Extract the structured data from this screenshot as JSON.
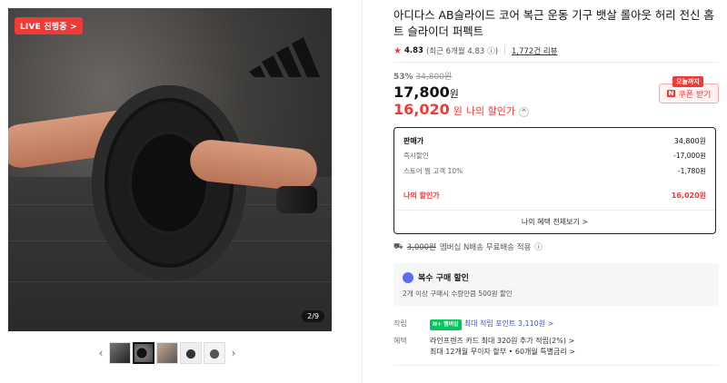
{
  "image": {
    "live_badge": "LIVE 진행중 >",
    "counter": "2/9"
  },
  "thumbs": {
    "prev": "‹",
    "next": "›"
  },
  "product": {
    "title": "아디다스 AB슬라이드 코어 복근 운동 기구 뱃살 롤아웃 허리 전신 홈트 슬라이더 퍼펙트",
    "rating": "4.83",
    "rating_sub": "(최근 6개월 4.83",
    "reviews": "1,772건 리뷰",
    "discount_pct": "53%",
    "orig_price": "34,800원",
    "price": "17,800",
    "price_unit": "원",
    "my_price": "16,020",
    "my_price_unit": "원",
    "my_price_label": "나의 할인가"
  },
  "coupon": {
    "today": "오늘까지",
    "n": "N",
    "label": "쿠폰 받기"
  },
  "breakdown": {
    "rows": [
      {
        "label": "판매가",
        "value": "34,800원"
      },
      {
        "label": "즉시할인",
        "value": "-17,000원"
      },
      {
        "label": "스토어 찜 고객 10%",
        "value": "-1,780원"
      }
    ],
    "my_label": "나의 할인가",
    "my_value": "16,020원",
    "foot": "나의 혜택 전체보기 >"
  },
  "shipping": {
    "strike": "3,000원",
    "text": "멤버십 N배송 무료배송 적용"
  },
  "multi": {
    "title": "복수 구매 할인",
    "desc": "2개 이상 구매시 수량만큼 500원 할인"
  },
  "points": {
    "label1": "적립",
    "npoint": "N+ 멤버십",
    "max": "최대 적립 포인트 3,110원 >",
    "label2": "혜택",
    "benefit1": "라인프렌즈 카드 최대 320원 추가 적립(2%) >",
    "benefit2": "최대 12개월 무이자 할부 • 60개월 특별금리 >"
  },
  "colors": {
    "accent": "#f03a36",
    "npay": "#03c75a",
    "blue": "#3757d8"
  }
}
